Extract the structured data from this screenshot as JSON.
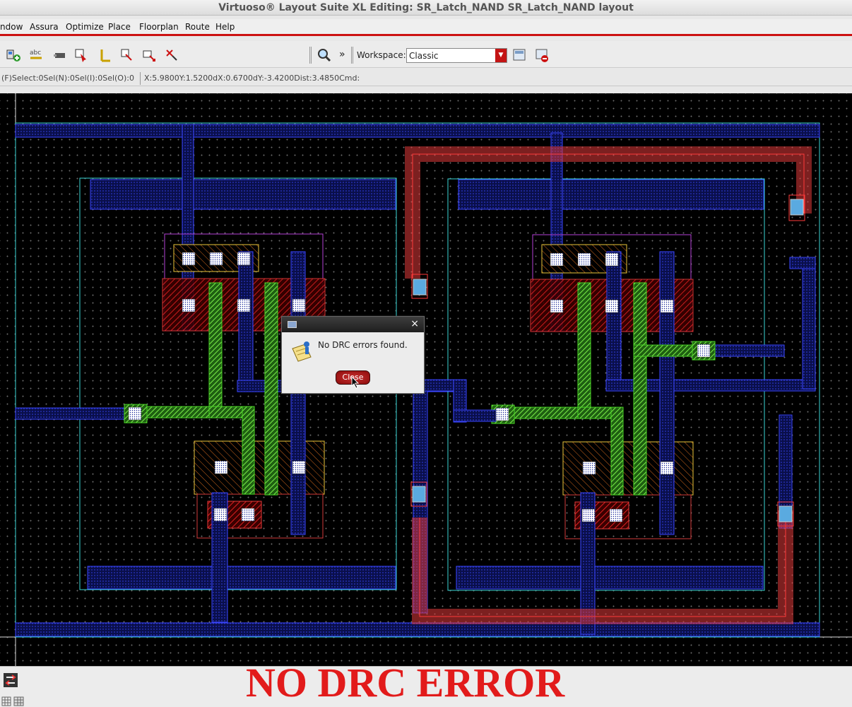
{
  "window": {
    "title": "Virtuoso® Layout Suite XL Editing: SR_Latch_NAND SR_Latch_NAND layout"
  },
  "menubar": {
    "items": [
      "ndow",
      "Assura",
      "Optimize",
      "Place",
      "Floorplan",
      "Route",
      "Help"
    ]
  },
  "toolbar": {
    "icons": [
      "create-instance-icon",
      "label-icon",
      "pin-icon",
      "select-icon",
      "ruler-icon",
      "copy-icon",
      "move-icon",
      "stretch-icon"
    ],
    "zoom_icon": "magnifier-icon",
    "more": "»",
    "workspace_label": "Workspace:",
    "workspace_value": "Classic",
    "workspace_icons": [
      "save-workspace-icon",
      "delete-workspace-icon"
    ]
  },
  "statusbar": {
    "selection": "(F)Select:0Sel(N):0Sel(I):0Sel(O):0",
    "coords": "X:5.9800Y:1.5200dX:0.6700dY:-3.4200Dist:3.4850Cmd:"
  },
  "dialog": {
    "message": "No DRC errors found.",
    "close_label": "Close",
    "icon": "info-icon"
  },
  "caption": "NO DRC ERROR",
  "bottombar": {
    "icons": [
      "layer-select-icon",
      "grid-icon",
      "table-icon"
    ]
  },
  "colors": {
    "accent": "#cc1111",
    "caption": "#e21b1b",
    "canvas_bg": "#000000"
  }
}
